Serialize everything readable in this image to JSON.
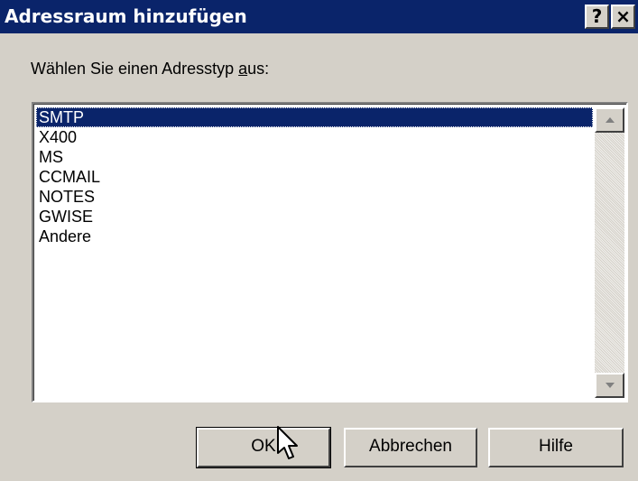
{
  "window": {
    "title": "Adressraum hinzufügen",
    "help_button": "?",
    "close_button": "×"
  },
  "prompt": {
    "text_before": "Wählen Sie einen Adresstyp ",
    "underlined": "a",
    "text_after": "us:"
  },
  "list": {
    "items": [
      {
        "label": "SMTP",
        "selected": true
      },
      {
        "label": "X400",
        "selected": false
      },
      {
        "label": "MS",
        "selected": false
      },
      {
        "label": "CCMAIL",
        "selected": false
      },
      {
        "label": "NOTES",
        "selected": false
      },
      {
        "label": "GWISE",
        "selected": false
      },
      {
        "label": "Andere",
        "selected": false
      }
    ]
  },
  "buttons": {
    "ok": "OK",
    "cancel": "Abbrechen",
    "help": "Hilfe"
  },
  "colors": {
    "titlebar": "#0a246a",
    "selection": "#0a246a",
    "face": "#d4d0c8"
  },
  "icons": {
    "help": "help-icon",
    "close": "close-icon",
    "scroll_up": "scroll-up-arrow-icon",
    "scroll_down": "scroll-down-arrow-icon",
    "cursor": "mouse-pointer-icon"
  }
}
